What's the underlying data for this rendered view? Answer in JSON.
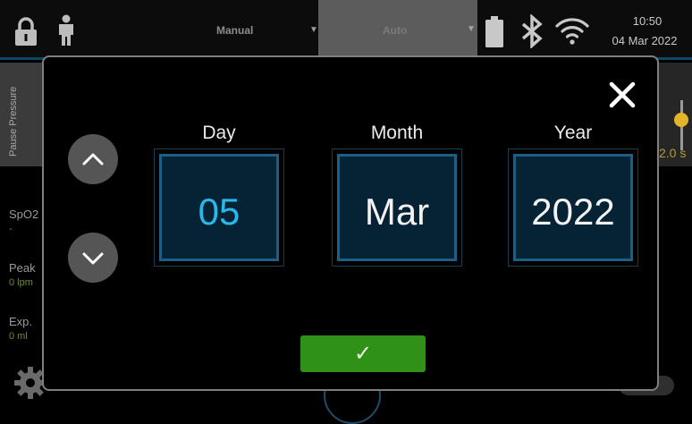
{
  "statusbar": {
    "mode_manual_label": "Manual",
    "mode_auto_label": "Auto",
    "dropdown_arrow": "▼",
    "time": "10:50",
    "date": "04 Mar 2022",
    "icons": [
      "lock-icon",
      "person-icon",
      "battery-icon",
      "bluetooth-icon",
      "wifi-icon"
    ]
  },
  "background": {
    "pause_label": "Pause Pressure",
    "slider_value": "2.0 s",
    "labels": [
      {
        "label": "SpO2",
        "value": "-"
      },
      {
        "label": "Peak",
        "value": "0 lpm"
      },
      {
        "label": "Exp.",
        "value": "0 ml"
      }
    ]
  },
  "dialog": {
    "close_icon": "close-icon",
    "up_icon": "chevron-up-icon",
    "down_icon": "chevron-down-icon",
    "fields": [
      {
        "label": "Day",
        "value": "05",
        "active": true
      },
      {
        "label": "Month",
        "value": "Mar",
        "active": false
      },
      {
        "label": "Year",
        "value": "2022",
        "active": false
      }
    ],
    "confirm_symbol": "✓"
  },
  "colors": {
    "accent_blue": "#29b8ea",
    "confirm_green": "#2f9118",
    "field_fill": "#062336",
    "slider_knob": "#e3b52a"
  }
}
